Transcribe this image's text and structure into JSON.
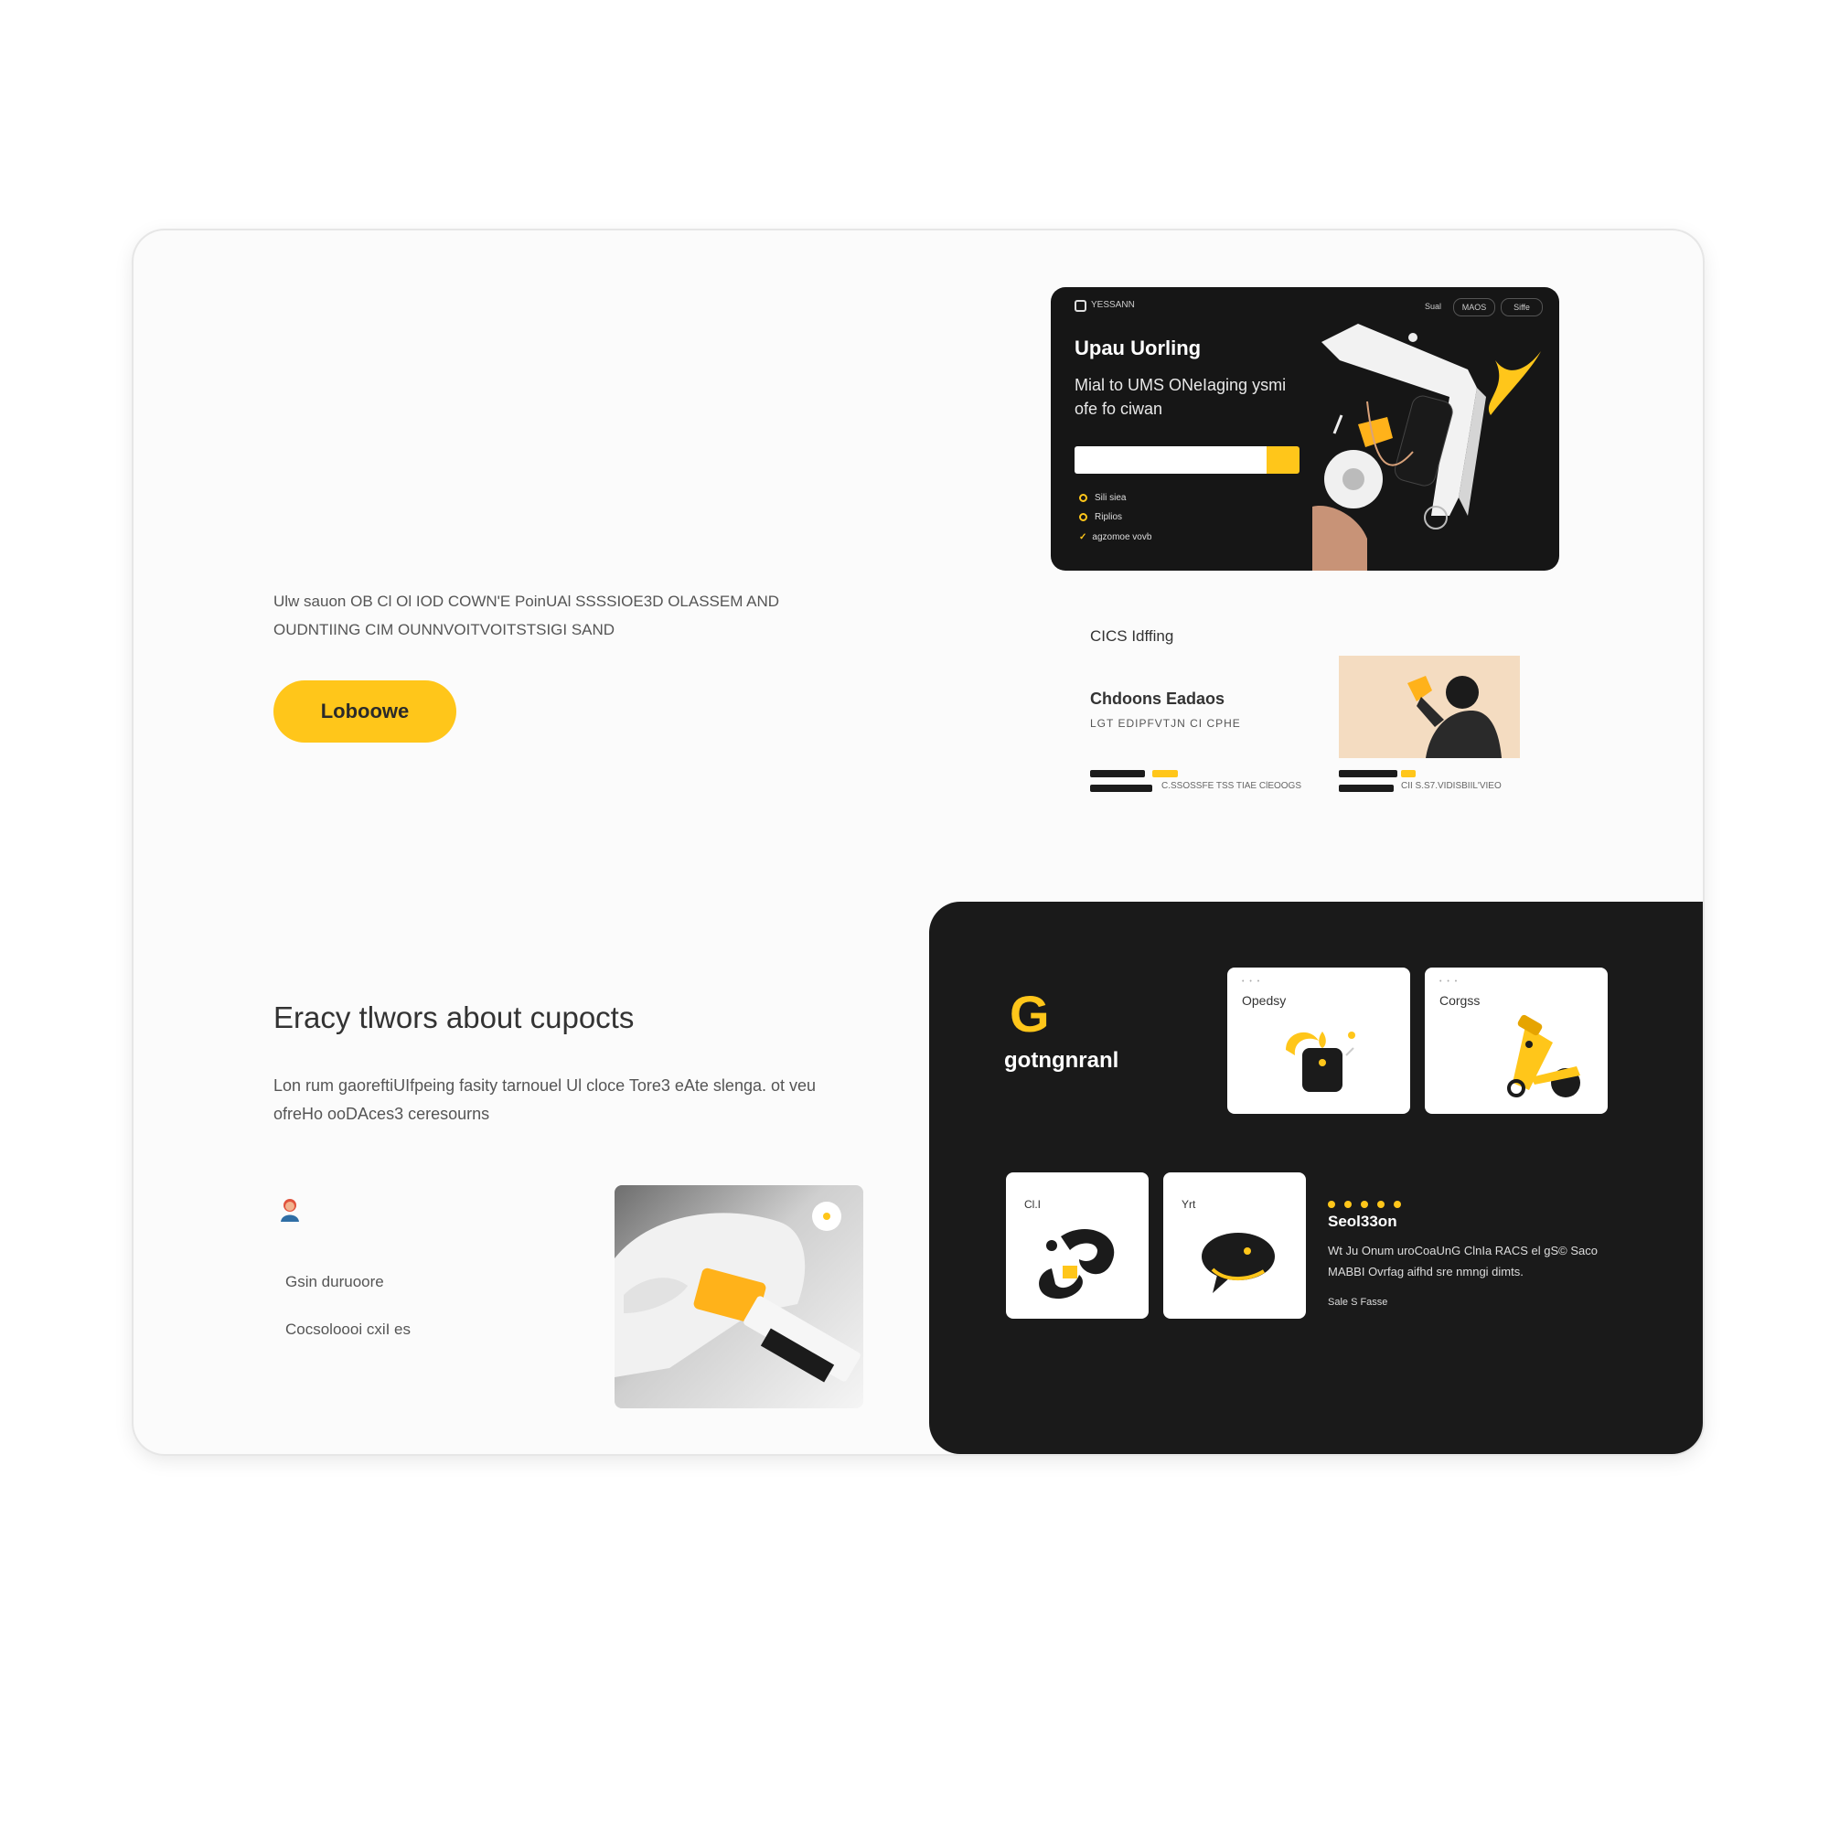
{
  "hero": {
    "description": "Ulw sauon OB Cl Ol IOD COWN'E PoinUAl SSSSIOE3D OLASSEM AND OUDNTIING CIM OUNNVOITVOITSTSIGI SAND",
    "cta_label": "Loboowe"
  },
  "mockup": {
    "brand": "YESSANN",
    "nav": [
      "Sual",
      "MAOS",
      "Siffe"
    ],
    "title": "Upau Uorling",
    "subtitle": "Mial to UMS ONeIaging ysmi ofe fo ciwan",
    "input_placeholder": "",
    "list": [
      "Sili siea",
      "Riplios",
      "agzomoe vovb"
    ]
  },
  "features": {
    "heading": "CICS Idffing",
    "item_title": "Chdoons Eadaos",
    "item_sub": "LGT EDIPFVTJN CI CPHE",
    "cap_left": "C.SSOSSFE TSS TIAE ClEOOGS",
    "cap_right": "CII S.S7.VIDISBIIL'VIEO"
  },
  "section2": {
    "title": "Eracy tlwors about cupocts",
    "body": "Lon rum gaoreftiUIfpeing fasity tarnouel Ul cloce Tore3 eAte slenga. ot veu ofreHo ooDAces3 ceresourns",
    "links": [
      "Gsin duruoore",
      "Cocsoloooi cxiI es"
    ]
  },
  "dark_panel": {
    "logo_letter": "G",
    "name": "gotngnranl",
    "tiles": [
      {
        "dots": "• • •",
        "label": "Opedsy"
      },
      {
        "dots": "• • •",
        "label": "Corgss"
      },
      {
        "dots": "",
        "label": "Cl.I"
      },
      {
        "dots": "",
        "label": "Yrt"
      }
    ],
    "section_title": "Seol33on",
    "section_body": "Wt Ju Onum uroCoaUnG ClnIa RACS el gS© Saco MABBI Ovrfag aifhd sre nmngi dimts.",
    "section_link": "Sale S Fasse"
  },
  "colors": {
    "accent": "#ffc61a",
    "dark": "#1a1a1a",
    "frame_bg": "#fbfbfb"
  },
  "icons": {
    "avatar": "person-avatar-icon",
    "check": "check-icon",
    "bullet": "ring-bullet-icon"
  }
}
